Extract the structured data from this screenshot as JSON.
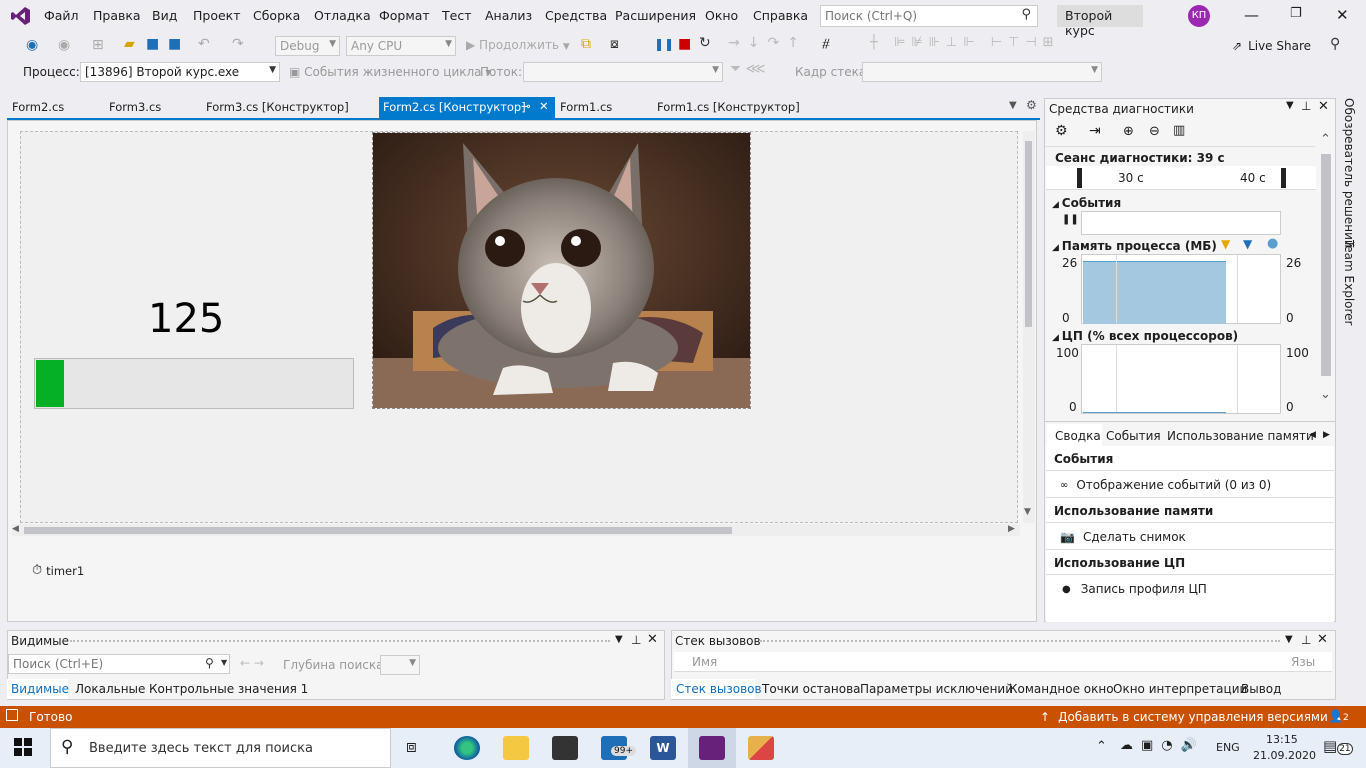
{
  "menu": [
    "Файл",
    "Правка",
    "Вид",
    "Проект",
    "Сборка",
    "Отладка",
    "Формат",
    "Тест",
    "Анализ",
    "Средства",
    "Расширения",
    "Окно",
    "Справка"
  ],
  "search_placeholder": "Поиск (Ctrl+Q)",
  "solution_name": "Второй курс",
  "avatar_initials": "КП",
  "toolbar": {
    "config": "Debug",
    "platform": "Any CPU",
    "continue": "Продолжить",
    "live_share": "Live Share",
    "process_label": "Процесс:",
    "process_value": "[13896] Второй курс.exe",
    "lifecycle": "События жизненного цикла",
    "thread_label": "Поток:",
    "stack_frame_label": "Кадр стека:"
  },
  "doc_tabs": [
    "Form2.cs",
    "Form3.cs",
    "Form3.cs [Конструктор]",
    "Form2.cs [Конструктор]",
    "Form1.cs",
    "Form1.cs [Конструктор]"
  ],
  "designer": {
    "counter": "125",
    "progress_fraction": 0.09,
    "component": "timer1",
    "picture_desc": "cat-photo"
  },
  "diag": {
    "title": "Средства диагностики",
    "session": "Сеанс диагностики: 39 с",
    "tick1": "30 с",
    "tick2": "40 с",
    "events_hdr": "События",
    "memory_hdr": "Память процесса (МБ)",
    "mem_max": "26",
    "mem_min": "0",
    "cpu_hdr": "ЦП (% всех процессоров)",
    "cpu_max": "100",
    "cpu_min": "0",
    "tabs": [
      "Сводка",
      "События",
      "Использование памяти"
    ],
    "sec_events": "События",
    "show_events": "Отображение событий (0 из 0)",
    "sec_mem": "Использование памяти",
    "snapshot": "Сделать снимок",
    "sec_cpu": "Использование ЦП",
    "cpu_profile": "Запись профиля ЦП"
  },
  "side_tabs": [
    "Обозреватель решений",
    "Team Explorer"
  ],
  "locals": {
    "title": "Видимые",
    "search": "Поиск (Ctrl+E)",
    "depth_label": "Глубина поиска:",
    "tabs": [
      "Видимые",
      "Локальные",
      "Контрольные значения 1"
    ]
  },
  "callstack": {
    "title": "Стек вызовов",
    "col_name": "Имя",
    "col_lang": "Язы",
    "tabs": [
      "Стек вызовов",
      "Точки останова",
      "Параметры исключений",
      "Командное окно",
      "Окно интерпретации",
      "Вывод"
    ]
  },
  "status": {
    "ready": "Готово",
    "vcs": "Добавить в систему управления версиями",
    "badge": "2"
  },
  "taskbar": {
    "search": "Введите здесь текст для поиска",
    "mail_badge": "99+",
    "lang": "ENG",
    "time": "13:15",
    "date": "21.09.2020",
    "notif": "21"
  },
  "colors": {
    "accent": "#007acc",
    "status": "#ca5100",
    "progress": "#06b025",
    "mem_fill": "#a3c8e0"
  }
}
